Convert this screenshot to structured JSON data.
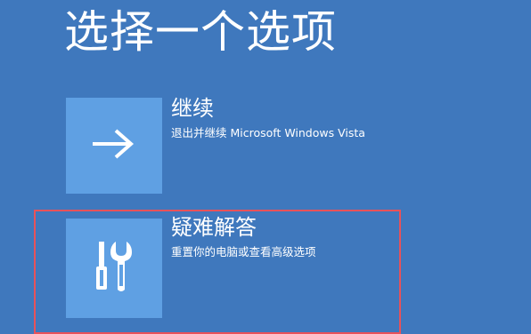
{
  "screen": {
    "title": "选择一个选项",
    "background_color": "#3f78bd",
    "tile_color": "#5fa0e3",
    "highlight_color": "#e8525a"
  },
  "options": [
    {
      "title": "继续",
      "description": "退出并继续 Microsoft Windows Vista",
      "icon": "arrow-right-icon"
    },
    {
      "title": "疑难解答",
      "description": "重置你的电脑或查看高级选项",
      "icon": "tools-icon"
    }
  ]
}
